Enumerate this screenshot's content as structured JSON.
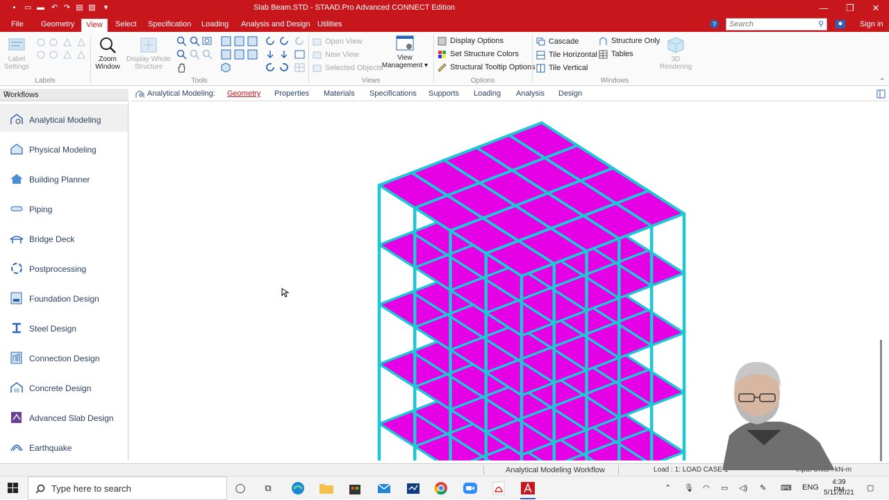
{
  "window": {
    "title": "Slab Beam.STD - STAAD.Pro Advanced CONNECT Edition",
    "sign_in": "Sign in"
  },
  "ribbon_tabs": [
    {
      "label": "File"
    },
    {
      "label": "Geometry"
    },
    {
      "label": "View"
    },
    {
      "label": "Select"
    },
    {
      "label": "Specification"
    },
    {
      "label": "Loading"
    },
    {
      "label": "Analysis and Design"
    },
    {
      "label": "Utilities"
    }
  ],
  "search": {
    "placeholder": "Search"
  },
  "ribbon": {
    "labels_group": {
      "name": "Labels",
      "label_settings": "Label Settings"
    },
    "tools_group": {
      "name": "Tools",
      "zoom_window": "Zoom Window",
      "display_whole": "Display Whole Structure"
    },
    "views_group": {
      "name": "Views",
      "open_view": "Open View",
      "new_view": "New View",
      "selected_objects": "Selected Objects",
      "view_management": "View Management ▾"
    },
    "options_group": {
      "name": "Options",
      "display_options": "Display Options",
      "structure_colors": "Set Structure Colors",
      "tooltip_options": "Structural Tooltip Options"
    },
    "windows_group": {
      "name": "Windows",
      "cascade": "Cascade",
      "tile_horizontal": "Tile Horizontal",
      "tile_vertical": "Tile Vertical",
      "structure_only": "Structure Only",
      "tables": "Tables",
      "rendering": "3D Rendering"
    }
  },
  "workflows": {
    "header": "Workflows",
    "items": [
      {
        "label": "Analytical Modeling"
      },
      {
        "label": "Physical Modeling"
      },
      {
        "label": "Building Planner"
      },
      {
        "label": "Piping"
      },
      {
        "label": "Bridge Deck"
      },
      {
        "label": "Postprocessing"
      },
      {
        "label": "Foundation Design"
      },
      {
        "label": "Steel Design"
      },
      {
        "label": "Connection Design"
      },
      {
        "label": "Concrete Design"
      },
      {
        "label": "Advanced Slab Design"
      },
      {
        "label": "Earthquake"
      }
    ]
  },
  "workflow_tabs": {
    "prefix": "Analytical Modeling:",
    "tabs": [
      {
        "label": "Geometry"
      },
      {
        "label": "Properties"
      },
      {
        "label": "Materials"
      },
      {
        "label": "Specifications"
      },
      {
        "label": "Supports"
      },
      {
        "label": "Loading"
      },
      {
        "label": "Analysis"
      },
      {
        "label": "Design"
      }
    ]
  },
  "status": {
    "workflow": "Analytical Modeling Workflow",
    "load": "Load : 1: LOAD CASE 1",
    "units": "Input Units : kN-m"
  },
  "taskbar": {
    "search_placeholder": "Type here to search",
    "lang": "ENG",
    "time": "4:39 PM",
    "date": "5/11/2021"
  },
  "colors": {
    "brand": "#c8161d",
    "beam": "#1fc7d3",
    "slab": "#e600e6"
  }
}
